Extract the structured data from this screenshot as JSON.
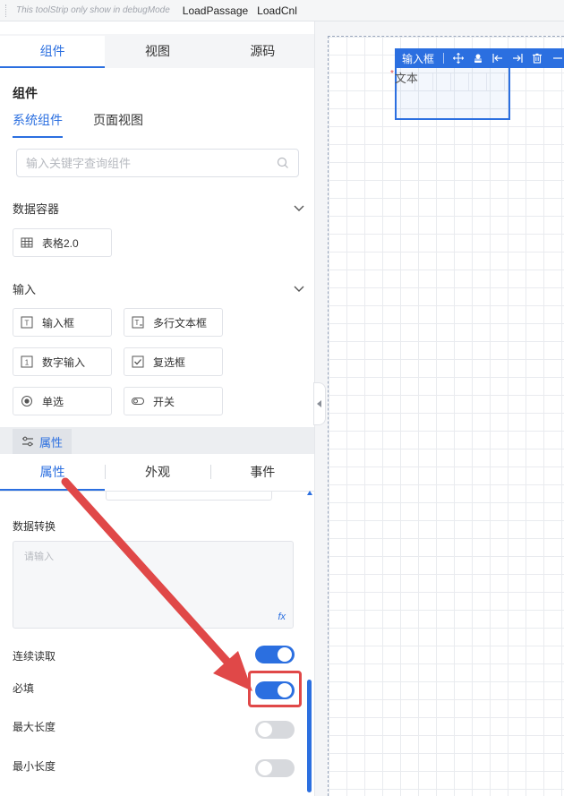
{
  "toolstrip": {
    "note": "This toolStrip only show in debugMode",
    "buttons": [
      "LoadPassage",
      "LoadCnl"
    ]
  },
  "top_tabs": [
    {
      "label": "组件",
      "active": true
    },
    {
      "label": "视图",
      "active": false
    },
    {
      "label": "源码",
      "active": false
    }
  ],
  "components_panel": {
    "title": "组件",
    "subtabs": [
      {
        "label": "系统组件",
        "active": true
      },
      {
        "label": "页面视图",
        "active": false
      }
    ],
    "search_placeholder": "输入关键字查询组件",
    "groups": [
      {
        "title": "数据容器",
        "items": [
          {
            "label": "表格2.0",
            "icon": "table-icon"
          }
        ]
      },
      {
        "title": "输入",
        "items": [
          {
            "label": "输入框",
            "icon": "text-input-icon"
          },
          {
            "label": "多行文本框",
            "icon": "textarea-icon"
          },
          {
            "label": "数字输入",
            "icon": "number-input-icon"
          },
          {
            "label": "复选框",
            "icon": "checkbox-icon"
          },
          {
            "label": "单选",
            "icon": "radio-icon"
          },
          {
            "label": "开关",
            "icon": "switch-icon"
          }
        ]
      }
    ]
  },
  "properties_panel": {
    "header_label": "属性",
    "tabs": [
      {
        "label": "属性",
        "active": true
      },
      {
        "label": "外观",
        "active": false
      },
      {
        "label": "事件",
        "active": false
      }
    ],
    "data_transform": {
      "label": "数据转换",
      "placeholder": "请输入",
      "fx_label": "fx"
    },
    "switches": [
      {
        "label": "连续读取",
        "on": true
      },
      {
        "label": "必填",
        "on": true,
        "highlighted": true
      },
      {
        "label": "最大长度",
        "on": false
      },
      {
        "label": "最小长度",
        "on": false
      }
    ]
  },
  "canvas": {
    "selected_component": {
      "toolbar_label": "输入框",
      "toolbar_icons": [
        "move-icon",
        "copy-icon",
        "align-left-icon",
        "align-right-icon",
        "delete-icon"
      ],
      "field_label": "文本",
      "required_mark": "*"
    }
  },
  "colors": {
    "accent": "#2b6fe0",
    "annotation_red": "#e04848",
    "switch_off": "#d7d9dd"
  }
}
